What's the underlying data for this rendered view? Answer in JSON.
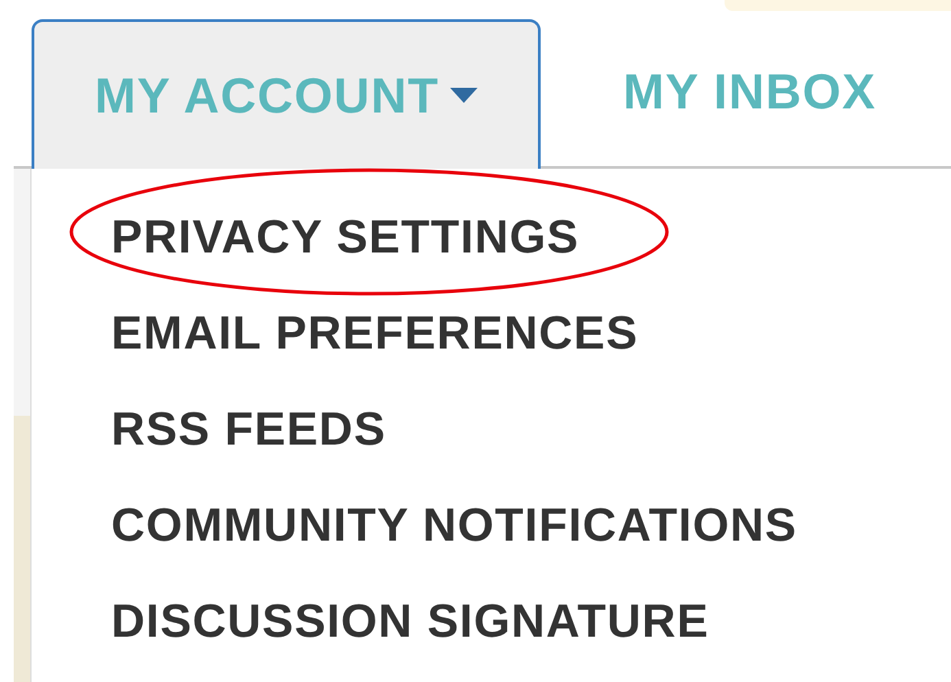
{
  "tabs": [
    {
      "label": "MY ACCOUNT",
      "selected": true,
      "has_menu": true
    },
    {
      "label": "MY INBOX",
      "selected": false,
      "has_menu": false
    }
  ],
  "menu": {
    "items": [
      {
        "label": "PRIVACY SETTINGS",
        "circled": true
      },
      {
        "label": "EMAIL PREFERENCES",
        "circled": false
      },
      {
        "label": "RSS FEEDS",
        "circled": false
      },
      {
        "label": "COMMUNITY NOTIFICATIONS",
        "circled": false
      },
      {
        "label": "DISCUSSION SIGNATURE",
        "circled": false
      }
    ]
  }
}
